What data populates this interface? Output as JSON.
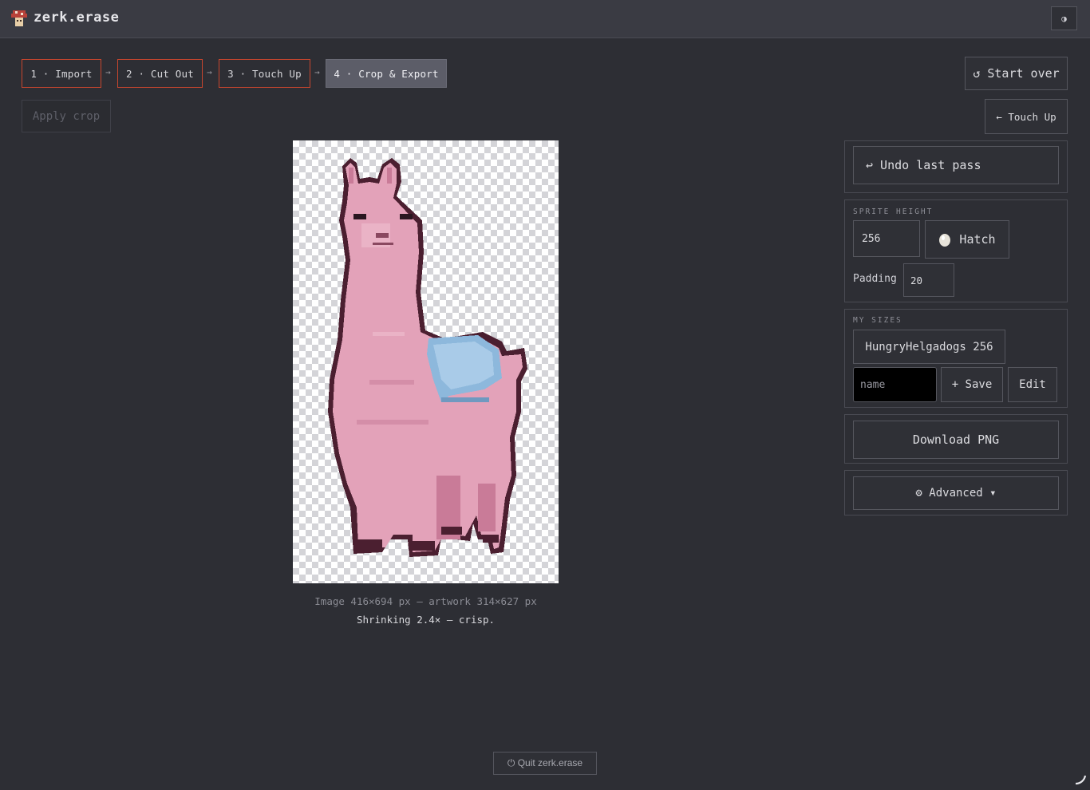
{
  "app": {
    "title": "zerk.erase",
    "theme_toggle_label": "◑"
  },
  "steps": [
    {
      "label": "1 · Import",
      "state": "done"
    },
    {
      "label": "2 · Cut Out",
      "state": "done"
    },
    {
      "label": "3 · Touch Up",
      "state": "done"
    },
    {
      "label": "4 · Crop & Export",
      "state": "active"
    }
  ],
  "step_separator": "→",
  "toolbar": {
    "start_over_label": "↺ Start over",
    "apply_crop_label": "Apply crop",
    "touch_up_back_label": "← Touch Up"
  },
  "preview": {
    "image_info": "Image 416×694 px — artwork 314×627 px",
    "scale_info": "Shrinking 2.4× — crisp."
  },
  "right_panel": {
    "undo_label": "↩ Undo last pass",
    "sprite_height": {
      "section_label": "SPRITE HEIGHT",
      "value": "256",
      "hatch_label": "Hatch",
      "padding_label": "Padding",
      "padding_value": "20"
    },
    "my_sizes": {
      "section_label": "MY SIZES",
      "items": [
        {
          "label": "HungryHelgadogs 256"
        }
      ],
      "name_placeholder": "name",
      "save_label": "+ Save",
      "edit_label": "Edit"
    },
    "download_label": "Download PNG",
    "advanced_label": "⚙ Advanced ▾"
  },
  "footer": {
    "quit_label": "⏻ Quit zerk.erase"
  },
  "colors": {
    "background": "#2d2e34",
    "header": "#3a3b43",
    "step_border": "#c8462e",
    "step_active": "#5c5d68",
    "llama_body": "#e3a2b9",
    "llama_outline": "#4b1f30",
    "saddle": "#8db8dc"
  }
}
